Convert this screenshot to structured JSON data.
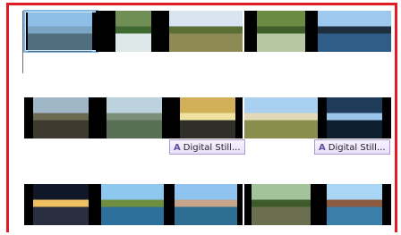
{
  "timeline": {
    "rows": [
      {
        "clips": [
          {
            "name": "clip-lake-valley",
            "sky": "#8dbfe6",
            "land": "#4f6f7e",
            "accent": "#7aa6c4"
          },
          {
            "name": "clip-waterfall",
            "sky": "#6f8f55",
            "land": "#dfe8e8",
            "accent": "#3f6b32"
          },
          {
            "name": "clip-cliffs",
            "sky": "#d8e4f0",
            "land": "#8d8a55",
            "accent": "#5b6e35"
          },
          {
            "name": "clip-greenery",
            "sky": "#6c8b42",
            "land": "#b6c7a2",
            "accent": "#3f5f28"
          },
          {
            "name": "clip-sailing-ship",
            "sky": "#9ec9ee",
            "land": "#2f5c88",
            "accent": "#1f2f3f"
          }
        ]
      },
      {
        "clips": [
          {
            "name": "clip-stone-bridge",
            "sky": "#9fb7c7",
            "land": "#3f3a2f",
            "accent": "#6c6a50"
          },
          {
            "name": "clip-lake-hills",
            "sky": "#bcd2df",
            "land": "#596f55",
            "accent": "#7d8f7a"
          },
          {
            "name": "clip-sunset-river",
            "sky": "#d2b05a",
            "land": "#2f2f28",
            "accent": "#f0e2a0"
          },
          {
            "name": "clip-country-road",
            "sky": "#a9cff1",
            "land": "#8a8d4b",
            "accent": "#e3d9b7"
          },
          {
            "name": "clip-forest-waterfall",
            "sky": "#1f3b5a",
            "land": "#0f1f2f",
            "accent": "#9bc6ea"
          }
        ],
        "labels": [
          {
            "text": "Digital Still...",
            "glyph": "A"
          },
          {
            "text": "Digital Still...",
            "glyph": "A"
          }
        ]
      },
      {
        "clips": [
          {
            "name": "clip-night-city",
            "sky": "#0f1728",
            "land": "#2a2f3f",
            "accent": "#f0c060"
          },
          {
            "name": "clip-coastal-bay",
            "sky": "#8cc8ef",
            "land": "#2c6f9a",
            "accent": "#6f8f3f"
          },
          {
            "name": "clip-sea-stacks",
            "sky": "#8fc4f0",
            "land": "#2e6e93",
            "accent": "#c6a58b"
          },
          {
            "name": "clip-ruins",
            "sky": "#a3c49a",
            "land": "#6b6f50",
            "accent": "#3d5a2a"
          },
          {
            "name": "clip-rocky-beach",
            "sky": "#a9d6f5",
            "land": "#3a7fa8",
            "accent": "#8c5a3f"
          }
        ]
      }
    ]
  },
  "colors": {
    "frame": "#e01b24",
    "selection": "#7fb4e3",
    "label_border": "#a99bd0"
  }
}
